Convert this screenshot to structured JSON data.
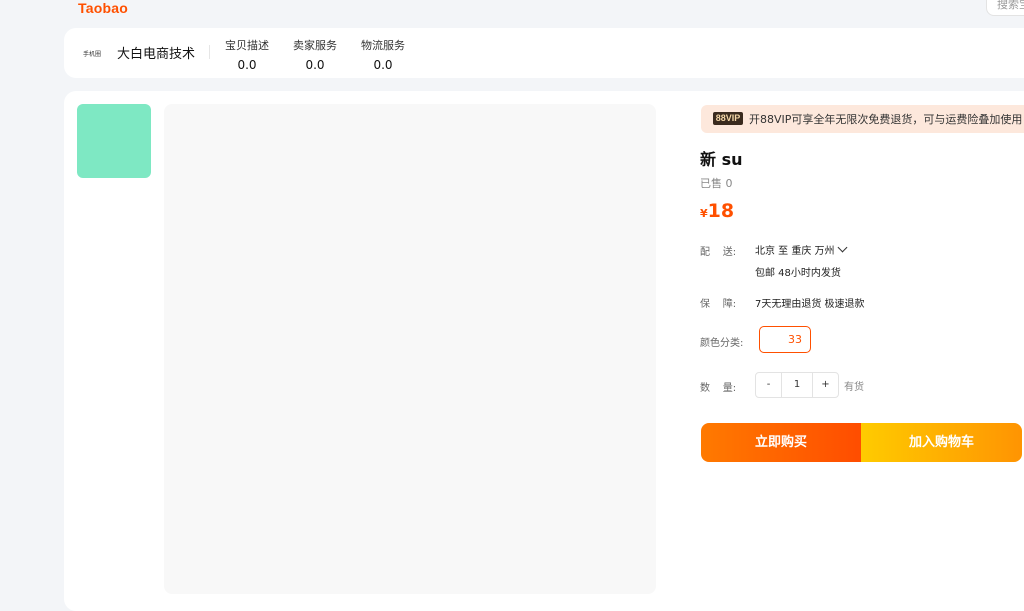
{
  "header": {
    "logo_text": "Taobao",
    "search_placeholder": "搜索宝"
  },
  "shop": {
    "icon_tag": "手机圈",
    "name": "大白电商技术",
    "scores": [
      {
        "label": "宝贝描述",
        "value": "0.0"
      },
      {
        "label": "卖家服务",
        "value": "0.0"
      },
      {
        "label": "物流服务",
        "value": "0.0"
      }
    ]
  },
  "vip": {
    "badge": "88VIP",
    "text": "开88VIP可享全年无限次免费退货，可与运费险叠加使用"
  },
  "product": {
    "title": "新 su",
    "sold": "已售 0",
    "currency": "¥",
    "price": "18",
    "delivery_label": "配    送:",
    "delivery_route": "北京   至   重庆 万州",
    "delivery_info": "包邮  48小时内发货",
    "guarantee_label": "保    障:",
    "guarantee_value": "7天无理由退货 极速退款",
    "color_label": "颜色分类:",
    "color_option": "33",
    "quantity_label": "数    量:",
    "quantity_minus": "-",
    "quantity_value": "1",
    "quantity_plus": "+",
    "stock": "有货"
  },
  "actions": {
    "buy_now": "立即购买",
    "add_to_cart": "加入购物车"
  },
  "colors": {
    "accent": "#ff5000",
    "thumb": "#7ee8c3"
  }
}
